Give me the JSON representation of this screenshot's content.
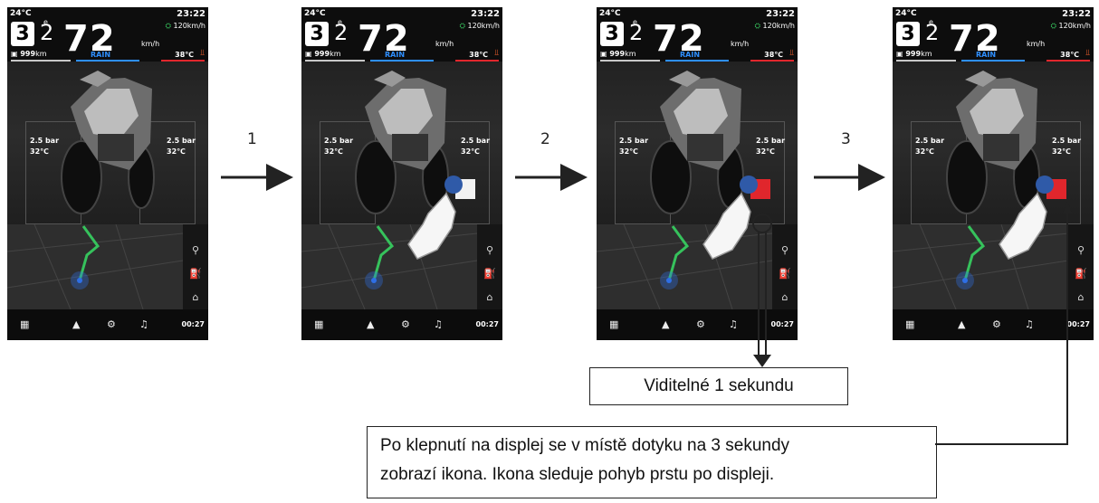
{
  "screens": [
    {
      "temp": "24°C",
      "time": "23:22",
      "gear": "3",
      "gear2": "2",
      "eco": "e",
      "speed": "72",
      "kmh": "km/h",
      "limit": "120km/h",
      "range_num": "999",
      "range_unit": "km",
      "mode": "RAIN",
      "engine_temp": "38℃",
      "pressure_front": "2.5 bar",
      "temp_front": "32℃",
      "pressure_rear": "2.5 bar",
      "temp_rear": "32℃",
      "clock": "00:27"
    },
    {
      "temp": "24°C",
      "time": "23:22",
      "gear": "3",
      "gear2": "2",
      "eco": "e",
      "speed": "72",
      "kmh": "km/h",
      "limit": "120km/h",
      "range_num": "999",
      "range_unit": "km",
      "mode": "RAIN",
      "engine_temp": "38℃",
      "pressure_front": "2.5 bar",
      "temp_front": "32℃",
      "pressure_rear": "2.5 bar",
      "temp_rear": "32℃",
      "clock": "00:27"
    },
    {
      "temp": "24°C",
      "time": "23:22",
      "gear": "3",
      "gear2": "2",
      "eco": "e",
      "speed": "72",
      "kmh": "km/h",
      "limit": "120km/h",
      "range_num": "999",
      "range_unit": "km",
      "mode": "RAIN",
      "engine_temp": "38℃",
      "pressure_front": "2.5 bar",
      "temp_front": "32℃",
      "pressure_rear": "2.5 bar",
      "temp_rear": "32℃",
      "clock": "00:27"
    },
    {
      "temp": "24°C",
      "time": "23:22",
      "gear": "3",
      "gear2": "2",
      "eco": "e",
      "speed": "72",
      "kmh": "km/h",
      "limit": "120km/h",
      "range_num": "999",
      "range_unit": "km",
      "mode": "RAIN",
      "engine_temp": "38℃",
      "pressure_front": "2.5 bar",
      "temp_front": "32℃",
      "pressure_rear": "2.5 bar",
      "temp_rear": "32℃",
      "clock": "00:27"
    }
  ],
  "steps": [
    "1",
    "2",
    "3"
  ],
  "callouts": {
    "visible_one_second": "Viditelné 1 sekundu",
    "tap_line1": "Po klepnutí na displej se v místě dotyku na 3 sekundy",
    "tap_line2": "zobrazí ikona. Ikona sleduje pohyb prstu po displeji."
  },
  "icons": {
    "search": "search-icon",
    "fuel": "fuel-icon",
    "home": "home-icon",
    "apps": "apps-icon",
    "navigate": "navigation-arrow-icon",
    "settings": "gear-icon",
    "music": "music-icon",
    "thermometer": "thermometer-icon",
    "speed_limit": "speed-limit-icon"
  },
  "colors": {
    "route": "#36c25c",
    "position": "#2e6fe6",
    "mode": "#2e8fff",
    "warning": "#e0262c",
    "icon_circle": "#2f5aa8"
  }
}
